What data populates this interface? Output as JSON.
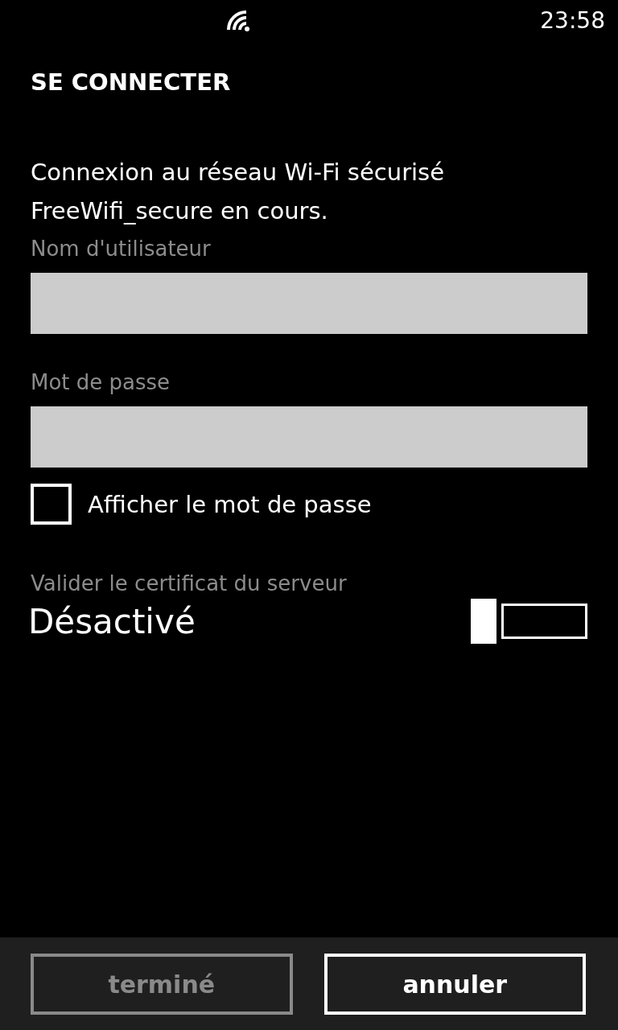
{
  "status_bar": {
    "time": "23:58"
  },
  "title": "SE CONNECTER",
  "message": "Connexion au réseau Wi-Fi sécurisé FreeWifi_secure en cours.",
  "fields": [
    {
      "label": "Nom d'utilisateur"
    },
    {
      "label": "Mot de passe"
    }
  ],
  "show_password": {
    "label": "Afficher le mot de passe",
    "checked": false
  },
  "certificate": {
    "label": "Valider le certificat du serveur",
    "state_text": "Désactivé",
    "on": false
  },
  "buttons": [
    {
      "label": "terminé",
      "disabled": true
    },
    {
      "label": "annuler",
      "disabled": false
    }
  ]
}
